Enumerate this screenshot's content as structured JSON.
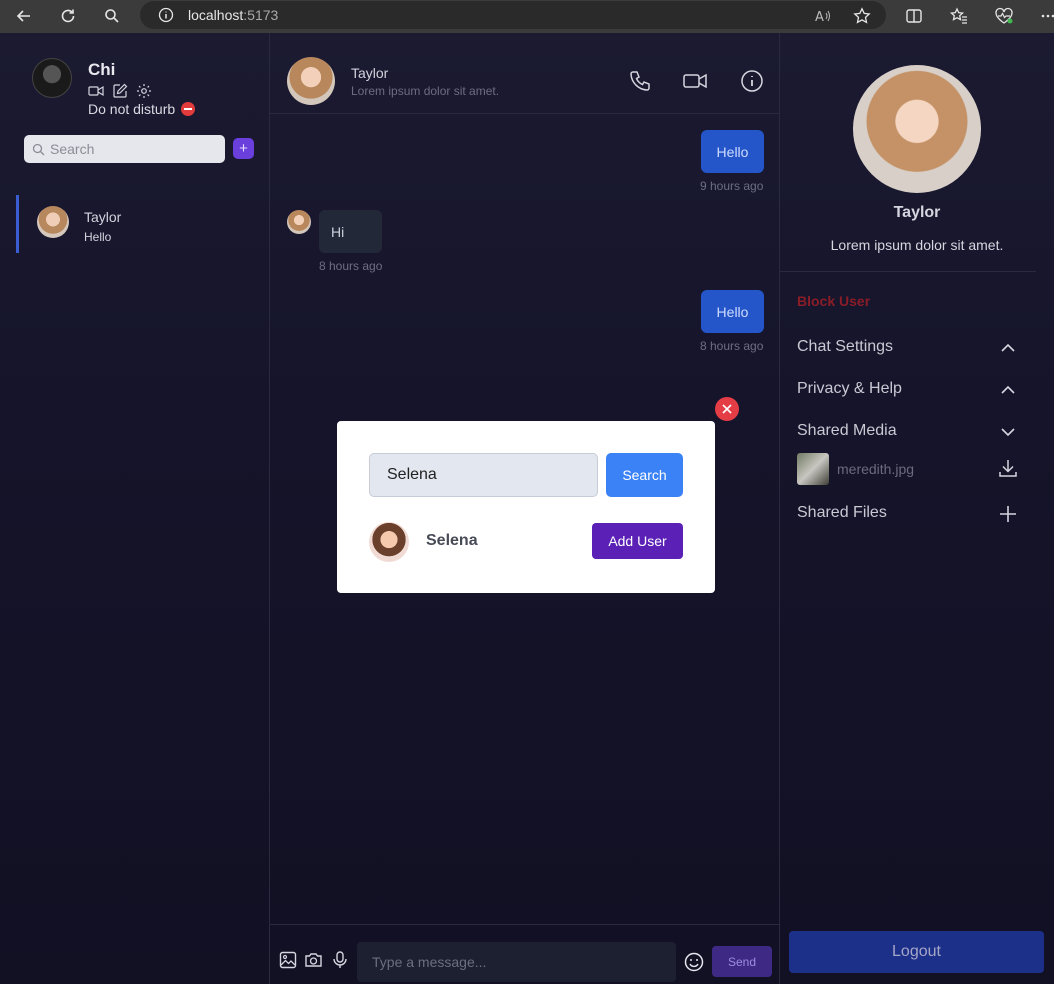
{
  "browser": {
    "url_host": "localhost",
    "url_port": ":5173"
  },
  "me": {
    "name": "Chi",
    "status": "Do not disturb"
  },
  "sidebar": {
    "search_placeholder": "Search",
    "add_label": "+",
    "chats": [
      {
        "name": "Taylor",
        "last_message": "Hello"
      }
    ]
  },
  "chat": {
    "name": "Taylor",
    "subtitle": "Lorem ipsum dolor sit amet.",
    "messages": [
      {
        "text": "Hello",
        "time": "9 hours ago",
        "own": true
      },
      {
        "text": "Hi",
        "time": "8 hours ago",
        "own": false
      },
      {
        "text": "Hello",
        "time": "8 hours ago",
        "own": true
      }
    ],
    "input_placeholder": "Type a message...",
    "send_label": "Send"
  },
  "details": {
    "name": "Taylor",
    "bio": "Lorem ipsum dolor sit amet.",
    "block_label": "Block User",
    "sections": [
      "Chat Settings",
      "Privacy & Help",
      "Shared Media",
      "Shared Files"
    ],
    "shared_file": "meredith.jpg",
    "logout_label": "Logout"
  },
  "modal": {
    "search_value": "Selena",
    "search_button": "Search",
    "result_name": "Selena",
    "add_button": "Add User"
  }
}
